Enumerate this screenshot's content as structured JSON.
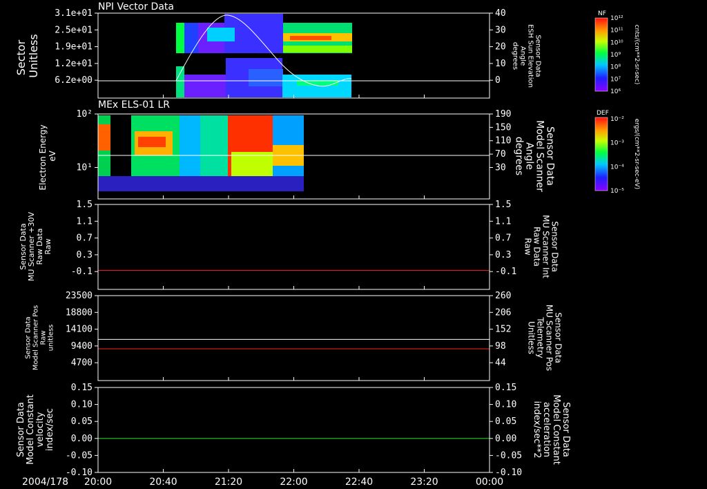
{
  "time_axis": {
    "date_label": "2004/178",
    "ticks": [
      "20:00",
      "20:40",
      "21:20",
      "22:00",
      "22:40",
      "23:20",
      "00:00"
    ]
  },
  "colorbars": {
    "nf": {
      "label": "NF",
      "unit": "cnts/(cm**2-sr-sec)",
      "ticks": [
        "10¹²",
        "10¹¹",
        "10¹⁰",
        "10⁹",
        "10⁸",
        "10⁷",
        "10⁶"
      ]
    },
    "def": {
      "label": "DEF",
      "unit": "ergs/(cm**2-sr-sec-eV)",
      "ticks": [
        "10⁻²",
        "10⁻³",
        "10⁻⁴",
        "10⁻⁵"
      ]
    }
  },
  "chart_data": [
    {
      "type": "heatmap",
      "title": "NPI Vector Data",
      "ylabel": "Sector\nUnitless",
      "yticks": [
        "3.1e+01",
        "2.5e+01",
        "1.9e+01",
        "1.2e+01",
        "6.2e+00"
      ],
      "y2label": "Sensor Data\nESH Sun Elevation\nAngle\ndegrees",
      "y2ticks": [
        "40",
        "30",
        "20",
        "10",
        "0"
      ],
      "y2lim": [
        -10,
        40
      ],
      "overlay_line": {
        "x": [
          "20:40",
          "21:00",
          "21:20",
          "21:40",
          "22:00",
          "22:20",
          "22:40"
        ],
        "y": [
          0,
          22,
          38,
          25,
          4,
          -4,
          1
        ]
      },
      "horizontal_line_y2": 0
    },
    {
      "type": "heatmap",
      "title": "MEx ELS-01 LR",
      "ylabel": "Electron Energy\neV",
      "yticks": [
        "10²",
        "10¹"
      ],
      "y2label": "Sensor Data\nModel Scanner\nAngle\ndegrees",
      "y2ticks": [
        "190",
        "150",
        "110",
        "70",
        "30"
      ],
      "horizontal_line_y2": 84
    },
    {
      "type": "line",
      "ylabel": "Sensor Data\nMU Scanner +30V\nRaw Data\nRaw",
      "yticks": [
        "1.5",
        "1.1",
        "0.7",
        "0.3",
        "-0.1"
      ],
      "ylim": [
        -0.3,
        1.5
      ],
      "y2label": "Sensor Data\nMU Scanner Int\nRaw Data\nRaw",
      "y2ticks": [
        "1.5",
        "1.1",
        "0.7",
        "0.3",
        "-0.1"
      ],
      "series": [
        {
          "name": "MU Scanner Int",
          "color": "#ff2020",
          "constant": 0.1
        }
      ]
    },
    {
      "type": "line",
      "ylabel": "Sensor Data\nModel Scanner Pos\nRaw\nunitless",
      "yticks": [
        "23500",
        "18800",
        "14100",
        "9400",
        "4700"
      ],
      "ylim": [
        0,
        23500
      ],
      "y2label": "Sensor Data\nMU Scanner Pos\nTelemetry\nUnitless",
      "y2ticks": [
        "260",
        "206",
        "152",
        "98",
        "44"
      ],
      "y2lim": [
        0,
        260
      ],
      "series": [
        {
          "name": "Model Scanner Pos",
          "color": "#ffffff",
          "constant": 11400
        },
        {
          "name": "MU Scanner Pos",
          "color": "#ff2020",
          "constant": 8800
        }
      ]
    },
    {
      "type": "line",
      "ylabel": "Sensor Data\nModel Constant\nvelocity\nindex/sec",
      "yticks": [
        "0.15",
        "0.10",
        "0.05",
        "0.00",
        "-0.05",
        "-0.10"
      ],
      "ylim": [
        -0.1,
        0.15
      ],
      "y2label": "Sensor Data\nModel Constant\nacceleration\nindex/sec**2",
      "y2ticks": [
        "0.15",
        "0.10",
        "0.05",
        "0.00",
        "-0.05",
        "-0.10"
      ],
      "series": [
        {
          "name": "Model Constant acceleration",
          "color": "#20e020",
          "constant": 0.0
        }
      ]
    }
  ]
}
